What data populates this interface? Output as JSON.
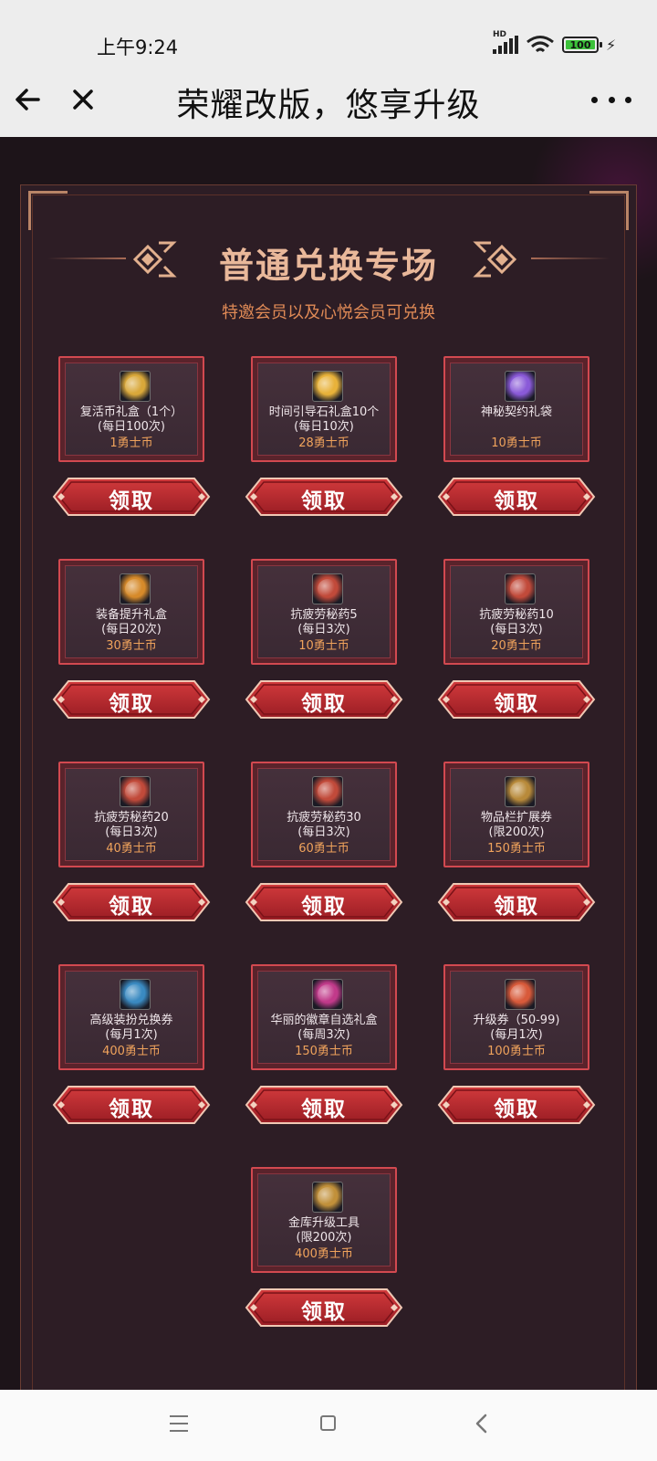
{
  "status_bar": {
    "time": "上午9:24",
    "network": "HD",
    "battery": "100"
  },
  "nav": {
    "title": "荣耀改版，悠享升级"
  },
  "header": {
    "title": "普通兑换专场",
    "subtitle": "特邀会员以及心悦会员可兑换"
  },
  "claim_label": "领取",
  "items": [
    {
      "name": "复活币礼盒（1个）",
      "limit": "(每日100次)",
      "price": "1勇士币",
      "icon": "revive-coin-box-icon",
      "color": "#d9a83a"
    },
    {
      "name": "时间引导石礼盒10个",
      "limit": "(每日10次)",
      "price": "28勇士币",
      "icon": "time-stone-box-icon",
      "color": "#e8b23a"
    },
    {
      "name": "神秘契约礼袋",
      "limit": "",
      "price": "10勇士币",
      "icon": "mystery-contract-bag-icon",
      "color": "#8a5ad8"
    },
    {
      "name": "装备提升礼盒",
      "limit": "(每日20次)",
      "price": "30勇士币",
      "icon": "equipment-upgrade-box-icon",
      "color": "#d68a2a"
    },
    {
      "name": "抗疲劳秘药5",
      "limit": "(每日3次)",
      "price": "10勇士币",
      "icon": "fatigue-potion-icon",
      "color": "#c14a3a"
    },
    {
      "name": "抗疲劳秘药10",
      "limit": "(每日3次)",
      "price": "20勇士币",
      "icon": "fatigue-potion-icon",
      "color": "#c14a3a"
    },
    {
      "name": "抗疲劳秘药20",
      "limit": "(每日3次)",
      "price": "40勇士币",
      "icon": "fatigue-potion-icon",
      "color": "#c14a3a"
    },
    {
      "name": "抗疲劳秘药30",
      "limit": "(每日3次)",
      "price": "60勇士币",
      "icon": "fatigue-potion-icon",
      "color": "#c14a3a"
    },
    {
      "name": "物品栏扩展券",
      "limit": "(限200次)",
      "price": "150勇士币",
      "icon": "inventory-expand-ticket-icon",
      "color": "#b88a3a"
    },
    {
      "name": "高级装扮兑换券",
      "limit": "(每月1次)",
      "price": "400勇士币",
      "icon": "avatar-exchange-ticket-icon",
      "color": "#3a8ac1"
    },
    {
      "name": "华丽的徽章自选礼盒",
      "limit": "(每周3次)",
      "price": "150勇士币",
      "icon": "emblem-box-icon",
      "color": "#c13a8a"
    },
    {
      "name": "升级券（50-99)",
      "limit": "(每月1次)",
      "price": "100勇士币",
      "icon": "level-up-ticket-icon",
      "color": "#d85a3a"
    },
    {
      "name": "金库升级工具",
      "limit": "(限200次)",
      "price": "400勇士币",
      "icon": "vault-upgrade-tool-icon",
      "color": "#c1903a"
    }
  ]
}
